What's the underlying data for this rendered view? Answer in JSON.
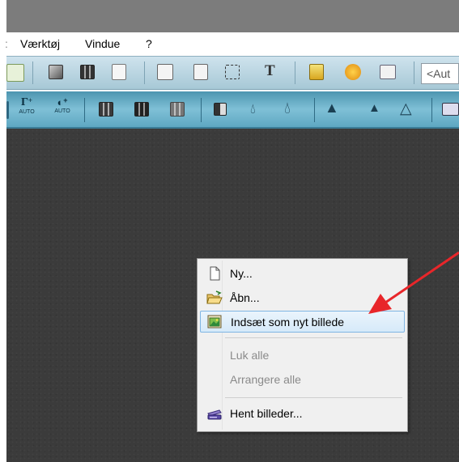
{
  "menubar": {
    "items": [
      ":",
      "Værktøj",
      "Vindue",
      "?"
    ]
  },
  "toolbar": {
    "combo_value": "<Aut"
  },
  "context_menu": {
    "items": [
      {
        "label": "Ny...",
        "icon": "new-document-icon",
        "state": "normal"
      },
      {
        "label": "Åbn...",
        "icon": "open-folder-icon",
        "state": "normal"
      },
      {
        "label": "Indsæt som nyt billede",
        "icon": "paste-image-icon",
        "state": "selected"
      },
      {
        "label": "Luk alle",
        "icon": "",
        "state": "disabled"
      },
      {
        "label": "Arrangere alle",
        "icon": "",
        "state": "disabled"
      },
      {
        "label": "Hent billeder...",
        "icon": "scanner-icon",
        "state": "normal"
      }
    ]
  },
  "colors": {
    "workspace": "#3b3b3b",
    "highlight_border": "#7fb5e3",
    "annotation_arrow": "#e8262a"
  }
}
